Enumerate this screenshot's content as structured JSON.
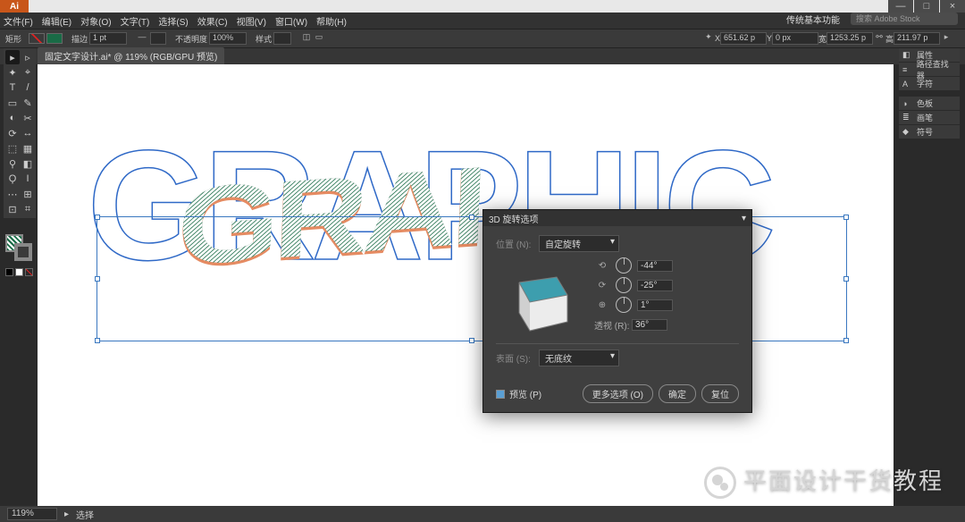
{
  "app": {
    "title": "Ai"
  },
  "window_controls": {
    "min": "—",
    "max": "□",
    "close": "×"
  },
  "menu": [
    "文件(F)",
    "编辑(E)",
    "对象(O)",
    "文字(T)",
    "选择(S)",
    "效果(C)",
    "视图(V)",
    "窗口(W)",
    "帮助(H)"
  ],
  "workspace_label": "传统基本功能",
  "search_placeholder": "搜索 Adobe Stock",
  "optbar": {
    "label_sel": "矩形",
    "stroke_w": "描边",
    "weight": "1 pt",
    "unit": "不透明度",
    "opacity": "100%",
    "style_lbl": "样式",
    "xlabel": "X",
    "x": "651.62 p",
    "ylabel": "Y",
    "y": "0 px",
    "wlabel": "宽",
    "w": "1253.25 p",
    "hlabel": "高",
    "h": "211.97 p"
  },
  "doc_tab": "固定文字设计.ai* @ 119% (RGB/GPU 预览)",
  "tools": [
    "▸",
    "▹",
    "✦",
    "⌖",
    "T",
    "/",
    "▭",
    "✎",
    "◐",
    "✂",
    "⟳",
    "↔",
    "⬚",
    "▦",
    "⚲",
    "◧",
    "Ϙ",
    "I",
    "⋯",
    "⊞",
    "⊡",
    "⌗"
  ],
  "color_swatches": [
    "#000000",
    "#ffffff",
    "#d22"
  ],
  "right_panels": [
    {
      "icon": "◧",
      "label": "属性"
    },
    {
      "icon": "≡",
      "label": "路径查找器"
    },
    {
      "icon": "A",
      "label": "字符"
    },
    {
      "gap": true
    },
    {
      "icon": "◑",
      "label": "色板"
    },
    {
      "icon": "≣",
      "label": "画笔"
    },
    {
      "icon": "◆",
      "label": "符号"
    }
  ],
  "canvas_text": "GRAPHIC",
  "dialog": {
    "title": "3D 旋转选项",
    "position_label": "位置 (N):",
    "position_value": "自定旋转",
    "axis_x_icon": "⟲",
    "axis_x": "-44°",
    "axis_y_icon": "⟳",
    "axis_y": "-25°",
    "axis_z_icon": "⊕",
    "axis_z": "1°",
    "persp_label": "透视 (R):",
    "persp_val": "36°",
    "surface_label": "表面 (S):",
    "surface_value": "无底纹",
    "preview_label": "预览 (P)",
    "more": "更多选项 (O)",
    "ok": "确定",
    "reset": "复位"
  },
  "status": {
    "zoom": "119%",
    "sel": "选择",
    "nav": "▸"
  },
  "watermark": "平面设计干货教程"
}
